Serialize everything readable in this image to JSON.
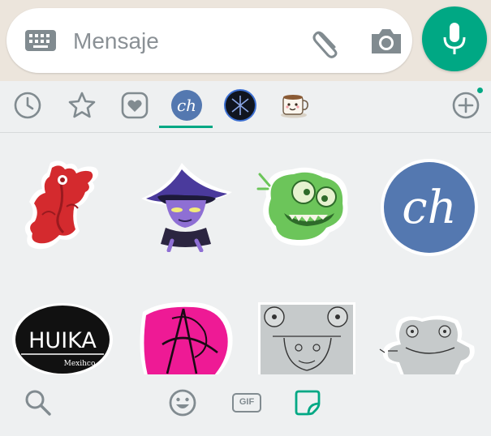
{
  "input_bar": {
    "placeholder": "Mensaje",
    "icons": [
      "keyboard-icon",
      "attach-icon",
      "camera-icon"
    ],
    "mic_icon": "mic-icon"
  },
  "tabs": [
    {
      "id": "recent",
      "icon": "clock-icon"
    },
    {
      "id": "favorites",
      "icon": "star-icon"
    },
    {
      "id": "love",
      "icon": "heart-icon"
    },
    {
      "id": "ch-pack",
      "icon": "ch-pack-icon",
      "selected": true
    },
    {
      "id": "bravo-pack",
      "icon": "bravo-pack-icon"
    },
    {
      "id": "mug-pack",
      "icon": "mug-pack-icon"
    },
    {
      "id": "add",
      "icon": "add-icon"
    }
  ],
  "stickers": {
    "ch_text": "ch",
    "huika_text": "HUIKA",
    "mexihco_text": "Mexihco"
  },
  "bottom_bar": {
    "gif_label": "GIF",
    "icons": [
      "search-icon",
      "emoji-icon",
      "gif-icon",
      "sticker-icon"
    ]
  },
  "colors": {
    "accent": "#00a884",
    "icon_gray": "#818b90",
    "ch_blue": "#5478b0"
  }
}
